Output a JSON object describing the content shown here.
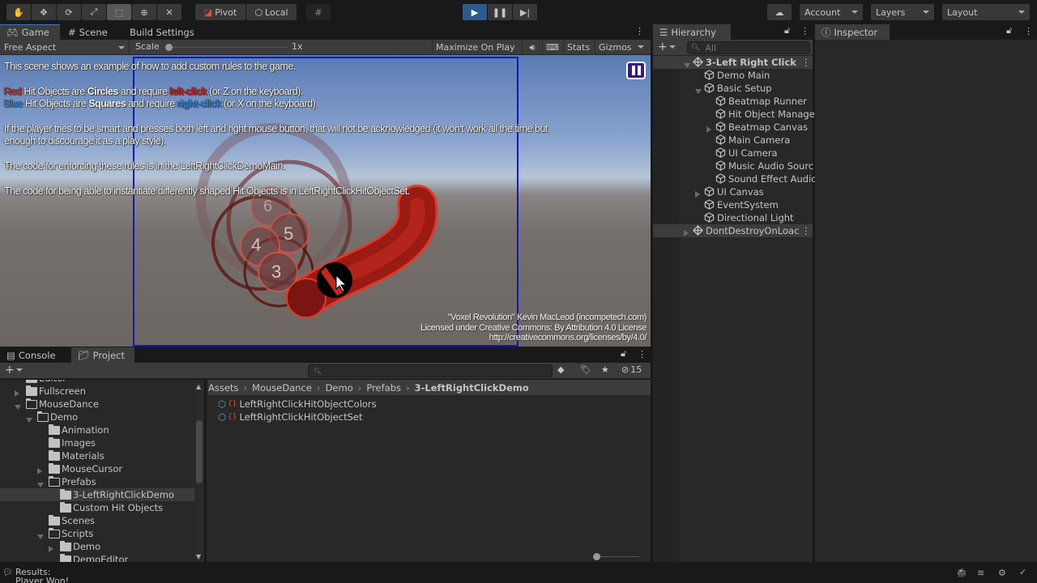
{
  "toolbar": {
    "tools": [
      "hand-tool",
      "move-tool",
      "rotate-tool",
      "scale-tool",
      "rect-tool",
      "transform-tool",
      "custom-tool"
    ],
    "active_tool": "rect-tool",
    "pivot_label": "Pivot",
    "local_label": "Local",
    "play_state": "playing",
    "account_label": "Account",
    "layers_label": "Layers",
    "layout_label": "Layout"
  },
  "game_panel": {
    "tabs": [
      {
        "label": "Game",
        "icon": "gamepad-icon",
        "selected": true
      },
      {
        "label": "Scene",
        "icon": "hash-icon",
        "selected": false
      },
      {
        "label": "Build Settings",
        "icon": "",
        "selected": false
      }
    ],
    "aspect": "Free Aspect",
    "scale_label": "Scale",
    "scale_value": "1x",
    "maximize_label": "Maximize On Play",
    "stats_label": "Stats",
    "gizmos_label": "Gizmos",
    "text_lines": {
      "l1": "This scene shows an example of how to add custom rules to the game.",
      "l2_red": "Red",
      "l2_a": " Hit Objects are ",
      "l2_b": "Circles",
      "l2_c": " and require ",
      "l2_d": "left-click",
      "l2_e": " (or Z on the keyboard).",
      "l3_blue": "Blue",
      "l3_a": " Hit Objects are ",
      "l3_b": "Squares",
      "l3_c": " and require ",
      "l3_d": "right-click",
      "l3_e": " (or X on the keyboard).",
      "l4": "If the player tries to be smart and presses both left and right mouse button, that will not be acknowledged (it won't work all the time but",
      "l5": "enough to discourage it as a play style).",
      "l6": "The code for enforcing these rules is in the LeftRightClickDemoMain.",
      "l7": "The code for being able to instantiate differently shaped Hit Objects is in LeftRightClickHitObjectSet."
    },
    "hit_numbers": [
      "6",
      "5",
      "4",
      "3"
    ],
    "credits": [
      "\"Voxel Revolution\" Kevin MacLeod (incompetech.com)",
      "Licensed under Creative Commons: By Attribution 4.0 License",
      "http://creativecommons.org/licenses/by/4.0/"
    ],
    "colors": {
      "red": "#e01010",
      "blue": "#2a7de1",
      "viewport_border": "#1010e0"
    }
  },
  "hierarchy": {
    "tab_label": "Hierarchy",
    "search_placeholder": "All",
    "items": [
      {
        "label": "3-Left Right Click",
        "depth": 0,
        "type": "scene",
        "expanded": true
      },
      {
        "label": "Demo Main",
        "depth": 1,
        "type": "object"
      },
      {
        "label": "Basic Setup",
        "depth": 1,
        "type": "object",
        "expanded": true
      },
      {
        "label": "Beatmap Runner",
        "depth": 2,
        "type": "object"
      },
      {
        "label": "Hit Object Manage",
        "depth": 2,
        "type": "object"
      },
      {
        "label": "Beatmap Canvas",
        "depth": 2,
        "type": "object",
        "collapsed": true
      },
      {
        "label": "Main Camera",
        "depth": 2,
        "type": "object"
      },
      {
        "label": "UI Camera",
        "depth": 2,
        "type": "object"
      },
      {
        "label": "Music Audio Sourc",
        "depth": 2,
        "type": "object"
      },
      {
        "label": "Sound Effect Audic",
        "depth": 2,
        "type": "object"
      },
      {
        "label": "UI Canvas",
        "depth": 1,
        "type": "object",
        "collapsed": true
      },
      {
        "label": "EventSystem",
        "depth": 1,
        "type": "object"
      },
      {
        "label": "Directional Light",
        "depth": 1,
        "type": "object"
      },
      {
        "label": "DontDestroyOnLoac",
        "depth": 0,
        "type": "scene",
        "collapsed": true
      }
    ]
  },
  "inspector": {
    "tab_label": "Inspector"
  },
  "bottom_panel": {
    "tabs": [
      {
        "label": "Console",
        "selected": false
      },
      {
        "label": "Project",
        "selected": true
      }
    ],
    "hidden_count": "15",
    "tree": [
      {
        "label": "Editor",
        "depth": 1
      },
      {
        "label": "Fullscreen",
        "depth": 1,
        "collapsed": true
      },
      {
        "label": "MouseDance",
        "depth": 1,
        "expanded": true
      },
      {
        "label": "Demo",
        "depth": 2,
        "expanded": true
      },
      {
        "label": "Animation",
        "depth": 3
      },
      {
        "label": "Images",
        "depth": 3
      },
      {
        "label": "Materials",
        "depth": 3
      },
      {
        "label": "MouseCursor",
        "depth": 3,
        "collapsed": true
      },
      {
        "label": "Prefabs",
        "depth": 3,
        "expanded": true
      },
      {
        "label": "3-LeftRightClickDemo",
        "depth": 4,
        "selected": true
      },
      {
        "label": "Custom Hit Objects",
        "depth": 4
      },
      {
        "label": "Scenes",
        "depth": 3
      },
      {
        "label": "Scripts",
        "depth": 3,
        "expanded": true
      },
      {
        "label": "Demo",
        "depth": 4,
        "collapsed": true
      },
      {
        "label": "DemoEditor",
        "depth": 4
      }
    ],
    "breadcrumb": [
      "Assets",
      "MouseDance",
      "Demo",
      "Prefabs",
      "3-LeftRightClickDemo"
    ],
    "files": [
      "LeftRightClickHitObjectColors",
      "LeftRightClickHitObjectSet"
    ]
  },
  "status_bar": {
    "message": "Results:",
    "message2": "Player Won!"
  }
}
